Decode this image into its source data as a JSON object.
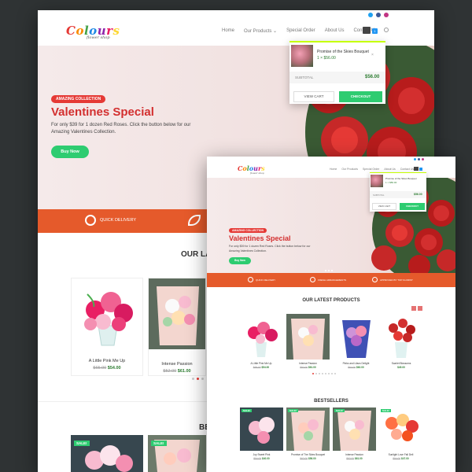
{
  "brand": {
    "logo_letters": [
      "C",
      "o",
      "l",
      "o",
      "u",
      "r",
      "s"
    ],
    "tagline": "flower shop"
  },
  "nav": {
    "items": [
      "Home",
      "Our Products",
      "Special Order",
      "About Us",
      "Contact Us"
    ],
    "cart_count": "1"
  },
  "colors": {
    "accent": "#e55a2b",
    "title_red": "#d32f2f",
    "button_green": "#2ecc71",
    "price_green": "#2e7d32",
    "cart_badge": "#2196f3"
  },
  "icons": [
    "twitter-icon",
    "facebook-icon",
    "instagram-icon",
    "cart-icon",
    "search-icon",
    "clock-icon",
    "leaf-icon",
    "award-icon"
  ],
  "hero": {
    "badge": "AMAZING COLLECTION",
    "title": "Valentines Special",
    "description": "For only $39 for 1 dozen Red Roses. Click the button below for our Amazing Valentines Collection.",
    "button": "Buy Now"
  },
  "features": [
    "QUICK DELIVERY",
    "FRESH ARRANGEMENTS",
    "APPROVED BY TOP FLORIST"
  ],
  "cart_popup": {
    "product_name": "Promise of the Skies Bouquet",
    "quantity_price": "1 × $56.00",
    "subtotal_label": "SUBTOTAL",
    "subtotal_value": "$56.00",
    "view_cart": "VIEW CART",
    "checkout": "CHECKOUT"
  },
  "latest": {
    "title_back": "OUR LA",
    "title_front": "OUR LATEST PRODUCTS",
    "products": [
      {
        "name": "A Little Pink Me Up",
        "old_price": "$65.00",
        "price": "$54.00"
      },
      {
        "name": "Intense Passion",
        "old_price": "$52.00",
        "price": "$61.00"
      },
      {
        "name": "Pinks and Lilacs Delight",
        "old_price": "$64.00",
        "price": "$62.00"
      },
      {
        "name": "Scarlet Blossoms",
        "old_price": "",
        "price": "$45.00"
      }
    ]
  },
  "bestsellers": {
    "title_back": "BE",
    "title_front": "BESTSELLERS",
    "sale_label": "SALE!",
    "products": [
      {
        "name": "Joy Sweet Pink",
        "old_price": "$54.00",
        "price": "$40.00"
      },
      {
        "name": "Promise of The Skies Bouquet",
        "old_price": "$62.00",
        "price": "$56.00"
      },
      {
        "name": "Intense Passion",
        "old_price": "$52.00",
        "price": "$61.00"
      },
      {
        "name": "Sunlight Love Fall Deli",
        "old_price": "$54.00",
        "price": "$47.00"
      }
    ]
  }
}
